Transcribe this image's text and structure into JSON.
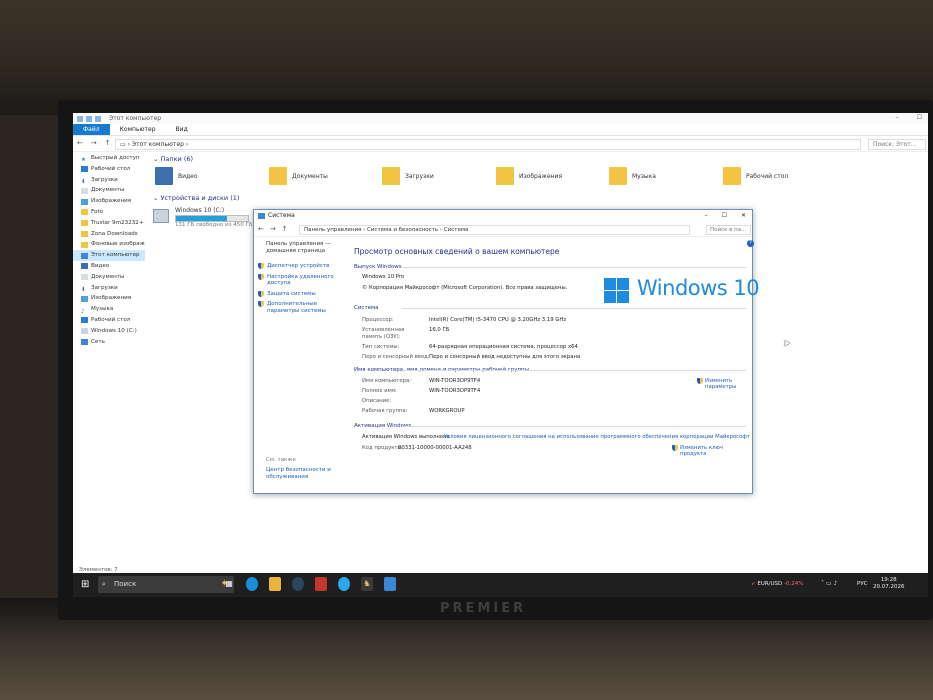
{
  "monitor": {
    "brand": "PREMIER"
  },
  "explorer": {
    "title": "Этот компьютер",
    "ribbon_tabs": [
      "Файл",
      "Компьютер",
      "Вид"
    ],
    "address": "Этот компьютер",
    "search_placeholder": "Поиск: Этот...",
    "nav": [
      "Быстрый доступ",
      "Рабочий стол",
      "Загрузки",
      "Документы",
      "Изображения",
      "Foto",
      "Trustar 9m23232+",
      "Zona Downloads",
      "Фоновые изображ",
      "Этот компьютер",
      "Видео",
      "Документы",
      "Загрузки",
      "Изображения",
      "Музыка",
      "Рабочий стол",
      "Windows 10 (C:)",
      "Сеть"
    ],
    "folders_header": "Папки (6)",
    "folders": [
      "Видео",
      "Документы",
      "Загрузки",
      "Изображения",
      "Музыка",
      "Рабочий стол"
    ],
    "devices_header": "Устройства и диски (1)",
    "drive": {
      "name": "Windows 10 (C:)",
      "free_text": "131 ГБ свободно из 450 ГБ",
      "used_fraction": 0.71
    },
    "status": "Элементов: 7"
  },
  "system": {
    "title": "Система",
    "breadcrumb": "Панель управления  ›  Система и безопасность  ›  Система",
    "search_placeholder": "Поиск в па...",
    "left": {
      "home": "Панель управления — домашняя страница",
      "links": [
        "Диспетчер устройств",
        "Настройка удаленного доступа",
        "Защита системы",
        "Дополнительные параметры системы"
      ],
      "see_also": "См. также",
      "security": "Центр безопасности и обслуживания"
    },
    "heading": "Просмотр основных сведений о вашем компьютере",
    "edition_header": "Выпуск Windows",
    "edition": "Windows 10 Pro",
    "copyright": "© Корпорация Майкрософт (Microsoft Corporation). Все права защищены.",
    "logo_text": "Windows 10",
    "system_header": "Система",
    "processor_label": "Процессор:",
    "processor": "Intel(R) Core(TM) i5-3470 CPU @ 3.20GHz   3.19 GHz",
    "ram_label": "Установленная память (ОЗУ):",
    "ram": "16,0 ГБ",
    "type_label": "Тип системы:",
    "type": "64-разрядная операционная система, процессор x64",
    "pen_label": "Перо и сенсорный ввод:",
    "pen": "Перо и сенсорный ввод недоступны для этого экрана",
    "name_header": "Имя компьютера, имя домена и параметры рабочей группы",
    "computer_name_label": "Имя компьютера:",
    "computer_name": "WIN-TOOR3OP9TF4",
    "full_name_label": "Полное имя:",
    "full_name": "WIN-TOOR3OP9TF4",
    "description_label": "Описание:",
    "workgroup_label": "Рабочая группа:",
    "workgroup": "WORKGROUP",
    "change_settings": "Изменить параметры",
    "activation_header": "Активация Windows",
    "activation_status": "Активация Windows выполнена",
    "license_link": "Условия лицензионного соглашения на использование программного обеспечения корпорации Майкрософт",
    "product_key_label": "Код продукта:",
    "product_key": "00331-10000-00001-AA248",
    "change_key": "Изменить ключ продукта"
  },
  "taskbar": {
    "search": "Поиск",
    "fx_pair": "EUR/USD",
    "fx_change": "-0,24%",
    "lang": "РУС",
    "time": "19:28",
    "date": "20.07.2026"
  }
}
